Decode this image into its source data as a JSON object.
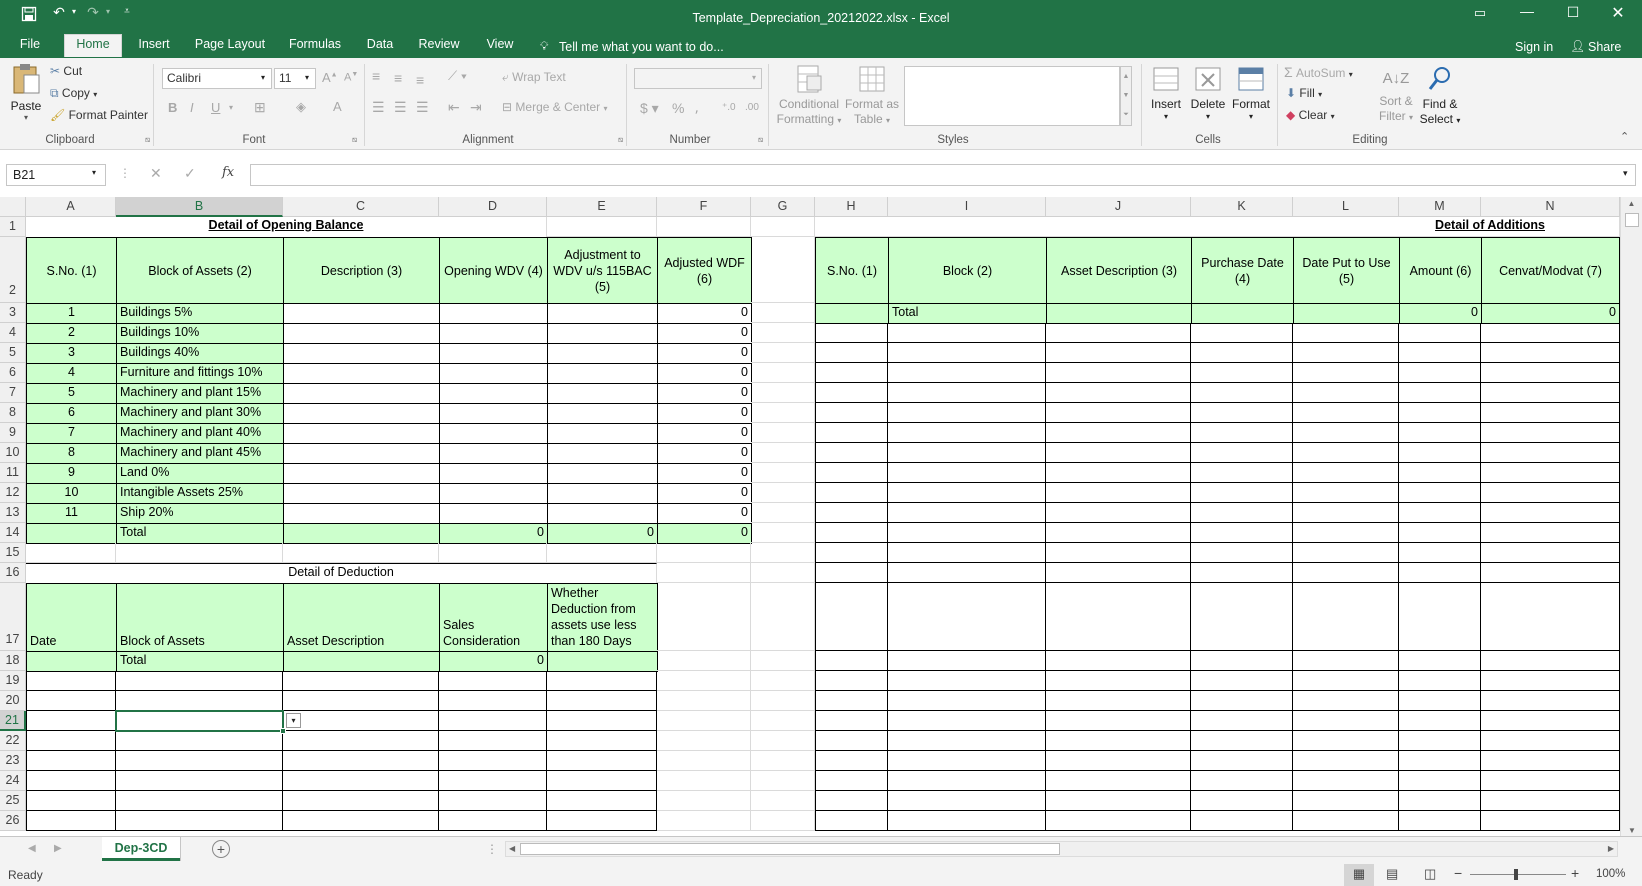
{
  "titlebar": {
    "title": "Template_Depreciation_20212022.xlsx - Excel"
  },
  "tabs": [
    "File",
    "Home",
    "Insert",
    "Page Layout",
    "Formulas",
    "Data",
    "Review",
    "View"
  ],
  "tell_me": "Tell me what you want to do...",
  "sign_in": "Sign in",
  "share": "Share",
  "ribbon": {
    "paste": "Paste",
    "cut": "Cut",
    "copy": "Copy",
    "format_painter": "Format Painter",
    "clipboard": "Clipboard",
    "font_name": "Calibri",
    "font_size": "11",
    "font": "Font",
    "wrap_text": "Wrap Text",
    "merge_center": "Merge & Center",
    "alignment": "Alignment",
    "number": "Number",
    "conditional": "Conditional",
    "formatting": "Formatting",
    "format_as": "Format as",
    "table": "Table",
    "styles": "Styles",
    "insert": "Insert",
    "delete": "Delete",
    "format": "Format",
    "cells": "Cells",
    "autosum": "AutoSum",
    "fill": "Fill",
    "clear": "Clear",
    "sort": "Sort &",
    "filter": "Filter",
    "find": "Find &",
    "select": "Select",
    "editing": "Editing"
  },
  "formula_bar": {
    "name_box": "B21",
    "formula": ""
  },
  "columns": [
    "A",
    "B",
    "C",
    "D",
    "E",
    "F",
    "G",
    "H",
    "I",
    "J",
    "K",
    "L",
    "M",
    "N"
  ],
  "rows": [
    "1",
    "2",
    "3",
    "4",
    "5",
    "6",
    "7",
    "8",
    "9",
    "10",
    "11",
    "12",
    "13",
    "14",
    "15",
    "16",
    "17",
    "18",
    "19",
    "20",
    "21",
    "22",
    "23",
    "24",
    "25",
    "26"
  ],
  "opening": {
    "title": "Detail of Opening Balance",
    "headers": [
      "S.No. (1)",
      "Block of Assets (2)",
      "Description (3)",
      "Opening WDV (4)",
      "Adjustment to WDV u/s 115BAC (5)",
      "Adjusted WDF (6)"
    ],
    "rows": [
      [
        "1",
        "Buildings 5%",
        "0"
      ],
      [
        "2",
        "Buildings 10%",
        "0"
      ],
      [
        "3",
        "Buildings 40%",
        "0"
      ],
      [
        "4",
        "Furniture and fittings 10%",
        "0"
      ],
      [
        "5",
        "Machinery and plant 15%",
        "0"
      ],
      [
        "6",
        "Machinery and plant 30%",
        "0"
      ],
      [
        "7",
        "Machinery and plant 40%",
        "0"
      ],
      [
        "8",
        "Machinery and plant 45%",
        "0"
      ],
      [
        "9",
        "Land 0%",
        "0"
      ],
      [
        "10",
        "Intangible Assets 25%",
        "0"
      ],
      [
        "11",
        "Ship 20%",
        "0"
      ]
    ],
    "total_label": "Total",
    "total_d": "0",
    "total_e": "0",
    "total_f": "0"
  },
  "deduction": {
    "title": "Detail of Deduction",
    "headers": [
      "Date",
      "Block of Assets",
      "Asset Description",
      "Sales Consideration",
      "Whether Deduction from assets use less than 180 Days"
    ],
    "total_label": "Total",
    "total_d": "0"
  },
  "additions": {
    "title": "Detail of Additions",
    "headers": [
      "S.No. (1)",
      "Block (2)",
      "Asset Description (3)",
      "Purchase Date (4)",
      "Date Put to Use (5)",
      "Amount (6)",
      "Cenvat/Modvat (7)"
    ],
    "total_label": "Total",
    "total_m": "0",
    "total_n": "0"
  },
  "sheet_tab": "Dep-3CD",
  "status": {
    "ready": "Ready",
    "zoom": "100%"
  }
}
